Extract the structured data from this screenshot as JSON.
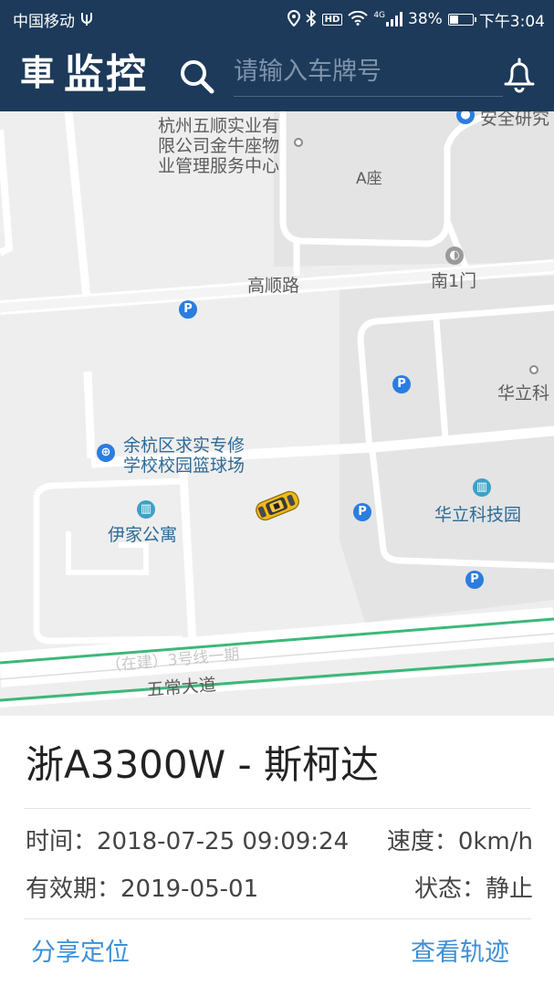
{
  "status_bar": {
    "carrier": "中国移动",
    "network": "4G",
    "battery_percent": "38%",
    "battery_level": 0.38,
    "time": "下午3:04"
  },
  "header": {
    "logo_char": "車",
    "title": "监控",
    "search_placeholder": "请输入车牌号"
  },
  "map": {
    "labels": {
      "company": [
        "杭州五顺实业有",
        "限公司金牛座物",
        "业管理服务中心"
      ],
      "building_a": "A座",
      "safety_institute": "安全研究",
      "south_gate": "南1门",
      "gaoshun_road": "高顺路",
      "huali_cut": "华立科",
      "court": [
        "余杭区求实专修",
        "学校校园篮球场"
      ],
      "yijia": "伊家公寓",
      "huali_park": "华立科技园",
      "metro": "（在建）3号线一期",
      "wuchang_avenue": "五常大道"
    },
    "poi_parking_symbol": "P"
  },
  "vehicle": {
    "title": "浙A3300W - 斯柯达",
    "time_label": "时间：",
    "time_value": "2018-07-25 09:09:24",
    "speed_label": "速度：",
    "speed_value": "0km/h",
    "valid_label": "有效期：",
    "valid_value": "2019-05-01",
    "status_label": "状态：",
    "status_value": "静止"
  },
  "actions": {
    "share": "分享定位",
    "track": "查看轨迹"
  },
  "colors": {
    "header_bg": "#1d3a5a",
    "link": "#3d8fd6",
    "metro_line": "#3cb878",
    "poi_blue": "#2b7de0"
  }
}
